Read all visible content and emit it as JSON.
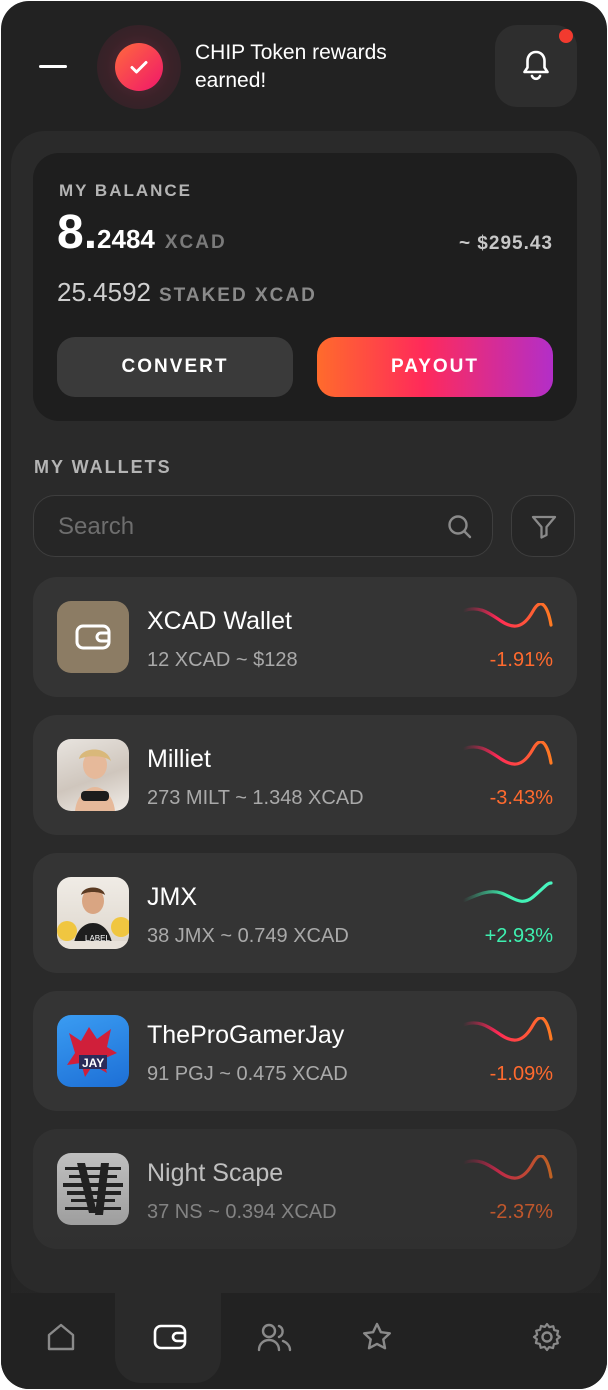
{
  "notification": {
    "text": "CHIP Token rewards earned!",
    "icon": "checkmark-badge-icon",
    "bell_icon": "bell-icon",
    "has_unread": true
  },
  "balance": {
    "label": "MY BALANCE",
    "amount_int": "8.",
    "amount_dec": "2484",
    "unit": "XCAD",
    "usd": "~ $295.43",
    "staked_int": "25.",
    "staked_dec": "4592",
    "staked_unit": "STAKED XCAD",
    "convert_label": "CONVERT",
    "payout_label": "PAYOUT"
  },
  "wallets": {
    "label": "MY WALLETS",
    "search_placeholder": "Search",
    "items": [
      {
        "name": "XCAD Wallet",
        "sub": "12 XCAD ~ $128",
        "change": "-1.91%",
        "trend": "down",
        "avatar": "wallet-icon"
      },
      {
        "name": "Milliet",
        "sub": "273 MILT ~ 1.348 XCAD",
        "change": "-3.43%",
        "trend": "down",
        "avatar": "creator-photo"
      },
      {
        "name": "JMX",
        "sub": "38 JMX ~ 0.749 XCAD",
        "change": "+2.93%",
        "trend": "up",
        "avatar": "creator-photo"
      },
      {
        "name": "TheProGamerJay",
        "sub": "91 PGJ ~ 0.475 XCAD",
        "change": "-1.09%",
        "trend": "down",
        "avatar": "jay-logo"
      },
      {
        "name": "Night Scape",
        "sub": "37 NS ~ 0.394 XCAD",
        "change": "-2.37%",
        "trend": "down",
        "avatar": "ns-logo"
      }
    ]
  },
  "colors": {
    "negative": "#ff6a2e",
    "positive": "#3ef0b0",
    "accent_start": "#ff6b2c",
    "accent_end": "#b32ec8"
  },
  "nav": [
    "home-icon",
    "wallet-icon",
    "users-icon",
    "star-icon",
    "settings-icon"
  ],
  "nav_active": "wallet-icon"
}
